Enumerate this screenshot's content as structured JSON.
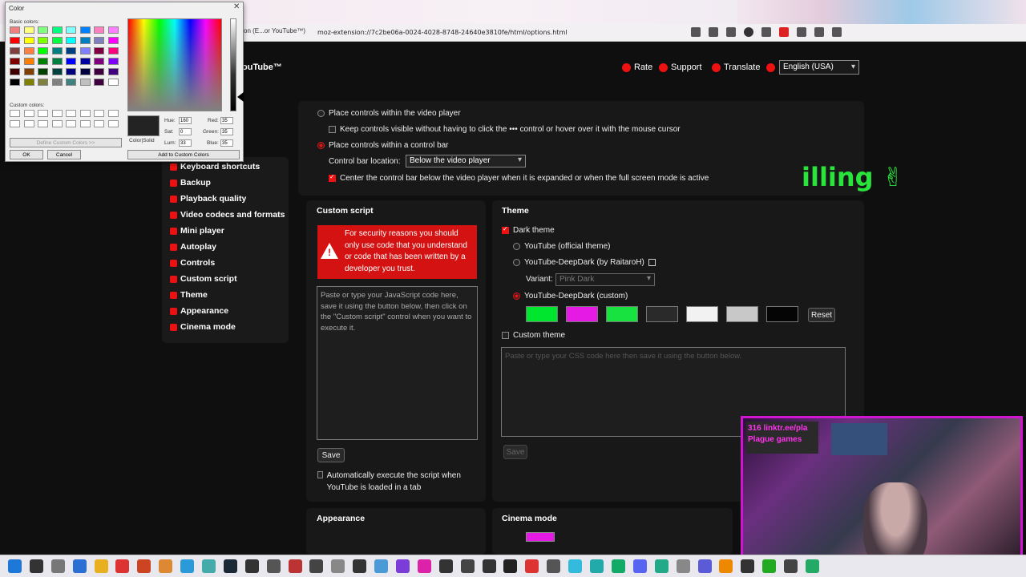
{
  "browser": {
    "tab_title": "tion (E...or YouTube™)",
    "url": "moz-extension://7c2be06a-0024-4028-8748-24640e3810fe/html/options.html"
  },
  "header": {
    "title": "ouTube™",
    "links": [
      "Rate",
      "Support",
      "Translate"
    ],
    "language": "English (USA)"
  },
  "sidebar": {
    "items": [
      "Keyboard shortcuts",
      "Backup",
      "Playback quality",
      "Video codecs and formats",
      "Mini player",
      "Autoplay",
      "Controls",
      "Custom script",
      "Theme",
      "Appearance",
      "Cinema mode"
    ]
  },
  "controls": {
    "opt_video_player": "Place controls within the video player",
    "opt_keep_visible": "Keep controls visible without having to click the ••• control or hover over it with the mouse cursor",
    "opt_control_bar": "Place controls within a control bar",
    "bar_location_label": "Control bar location:",
    "bar_location_value": "Below the video player",
    "center_bar": "Center the control bar below the video player when it is expanded or when the full screen mode is active"
  },
  "overlay_text": "illing ✌",
  "custom_script": {
    "title": "Custom script",
    "warning": "For security reasons you should only use code that you understand or code that has been written by a developer you trust.",
    "placeholder": "Paste or type your JavaScript code here, save it using the button below, then click on the \"Custom script\" control when you want to execute it.",
    "save": "Save",
    "auto_execute": "Automatically execute the script when YouTube is loaded in a tab"
  },
  "theme": {
    "title": "Theme",
    "dark_theme": "Dark theme",
    "official": "YouTube (official theme)",
    "deepdark": "YouTube-DeepDark (by RaitaroH)",
    "variant_label": "Variant:",
    "variant_value": "Pink Dark",
    "custom_deepdark": "YouTube-DeepDark (custom)",
    "swatches": [
      "#00e62e",
      "#e51ae5",
      "#18e240",
      "#2a2a2a",
      "#f2f2f2",
      "#c8c8c8",
      "#050505"
    ],
    "reset": "Reset",
    "custom_theme": "Custom theme",
    "css_placeholder": "Paste or type your CSS code here then save it using the button below.",
    "save": "Save"
  },
  "bottom": {
    "appearance": "Appearance",
    "cinema_mode": "Cinema mode"
  },
  "webcam": {
    "badge_line1": "316 linktr.ee/pla",
    "badge_line2": "Plague games"
  },
  "color_dialog": {
    "title": "Color",
    "basic_colors_label": "Basic colors:",
    "custom_colors_label": "Custom colors:",
    "define_custom": "Define Custom Colors >>",
    "ok": "OK",
    "cancel": "Cancel",
    "color_solid": "Color|Solid",
    "add_custom": "Add to Custom Colors",
    "hue_label": "Hue:",
    "hue": "160",
    "sat_label": "Sat:",
    "sat": "0",
    "lum_label": "Lum:",
    "lum": "33",
    "red_label": "Red:",
    "red": "35",
    "green_label": "Green:",
    "green": "35",
    "blue_label": "Blue:",
    "blue": "35",
    "basic_colors": [
      "#f08080",
      "#ffff80",
      "#80ff80",
      "#00ff80",
      "#80ffff",
      "#0080ff",
      "#ff80c0",
      "#ff80ff",
      "#ff0000",
      "#ffff00",
      "#80ff00",
      "#00ff40",
      "#00ffff",
      "#0080c0",
      "#8080c0",
      "#ff00ff",
      "#804040",
      "#ff8040",
      "#00ff00",
      "#008080",
      "#004080",
      "#8080ff",
      "#800040",
      "#ff0080",
      "#800000",
      "#ff8000",
      "#008000",
      "#008040",
      "#0000ff",
      "#0000a0",
      "#800080",
      "#8000ff",
      "#400000",
      "#804000",
      "#004000",
      "#004040",
      "#000080",
      "#000040",
      "#400040",
      "#400080",
      "#000000",
      "#808000",
      "#808040",
      "#808080",
      "#408080",
      "#c0c0c0",
      "#400040",
      "#ffffff"
    ]
  }
}
